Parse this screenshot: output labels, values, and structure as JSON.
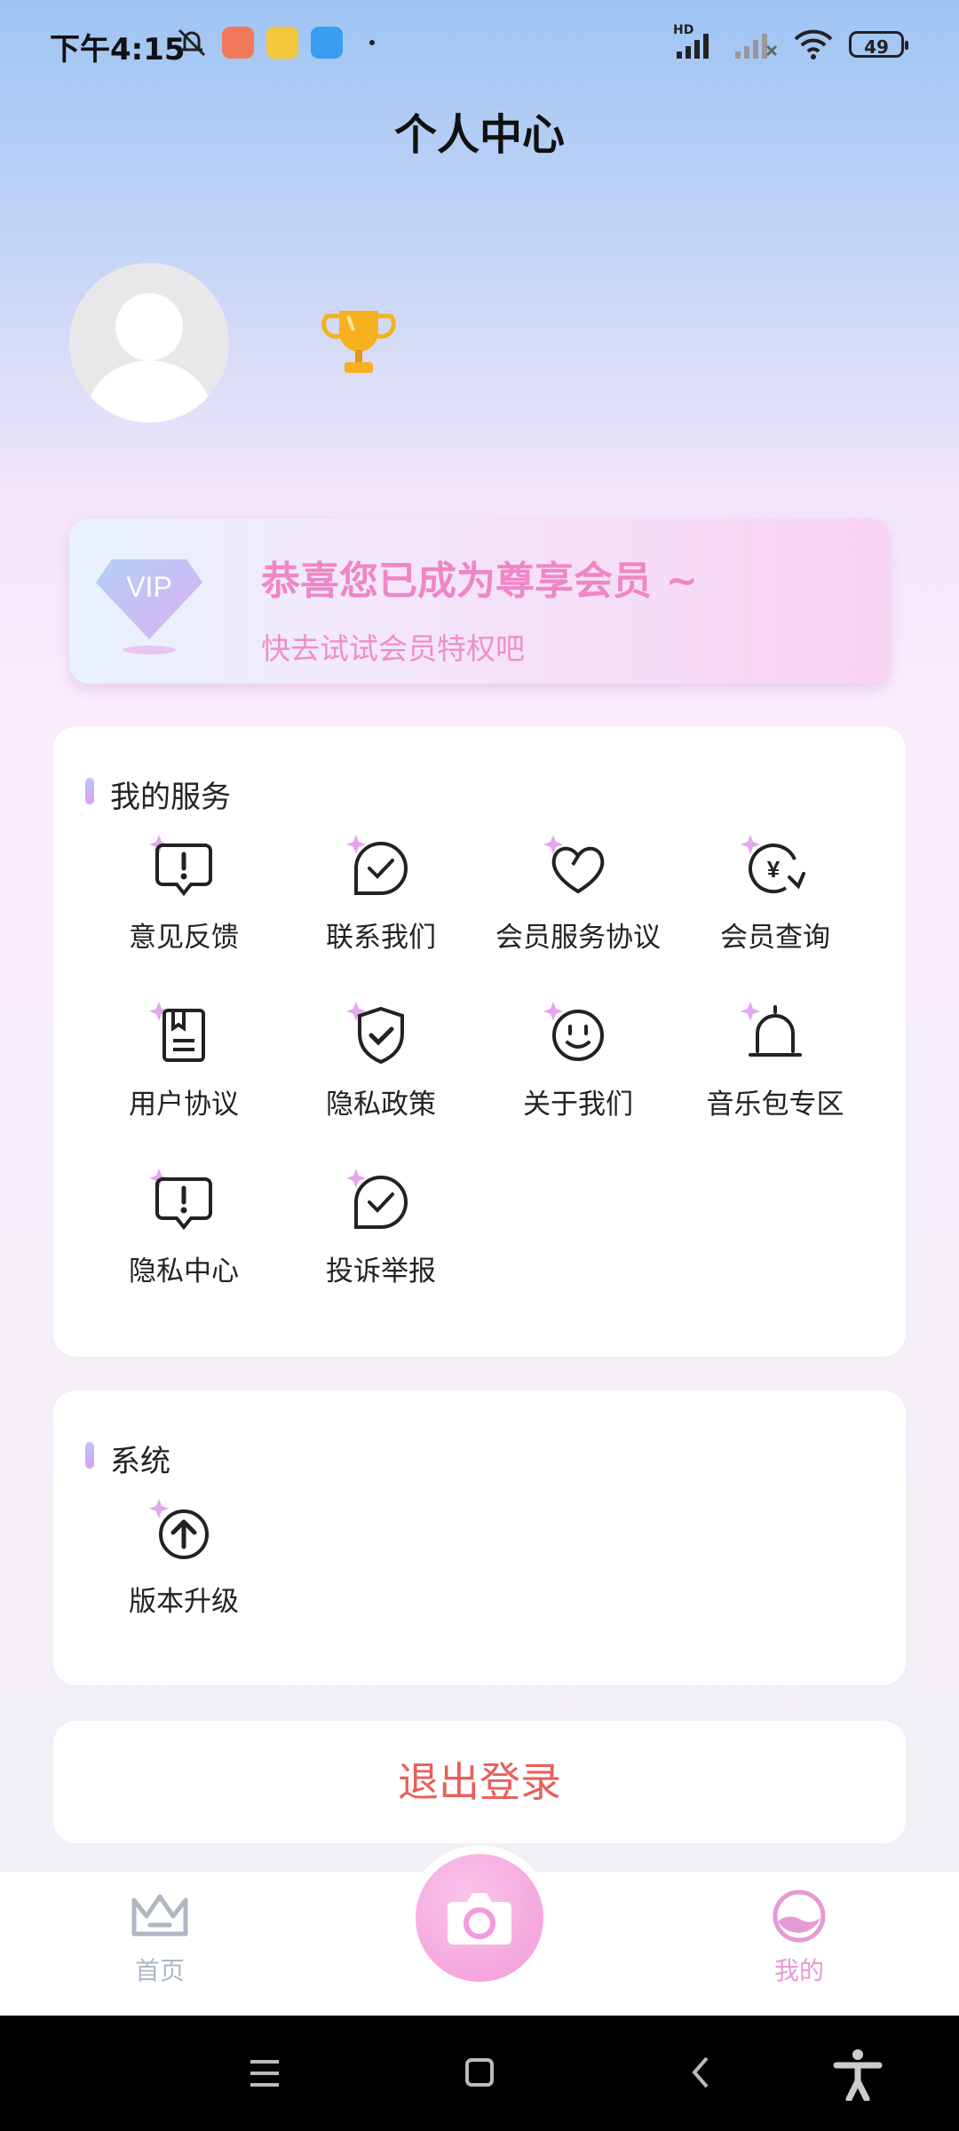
{
  "status_bar": {
    "time": "下午4:15",
    "battery": "49",
    "network_label": "HD"
  },
  "header": {
    "title": "个人中心"
  },
  "vip_card": {
    "badge": "VIP",
    "headline": "恭喜您已成为尊享会员 ~",
    "subline": "快去试试会员特权吧"
  },
  "services": {
    "title": "我的服务",
    "items": [
      {
        "label": "意见反馈",
        "icon": "feedback-icon"
      },
      {
        "label": "联系我们",
        "icon": "chat-check-icon"
      },
      {
        "label": "会员服务协议",
        "icon": "heart-icon"
      },
      {
        "label": "会员查询",
        "icon": "yen-refresh-icon"
      },
      {
        "label": "用户协议",
        "icon": "document-icon"
      },
      {
        "label": "隐私政策",
        "icon": "shield-check-icon"
      },
      {
        "label": "关于我们",
        "icon": "smile-icon"
      },
      {
        "label": "音乐包专区",
        "icon": "bell-icon"
      },
      {
        "label": "隐私中心",
        "icon": "feedback-icon"
      },
      {
        "label": "投诉举报",
        "icon": "chat-check-icon"
      }
    ]
  },
  "system": {
    "title": "系统",
    "items": [
      {
        "label": "版本升级",
        "icon": "upload-arrow-icon"
      }
    ]
  },
  "logout": {
    "label": "退出登录"
  },
  "tabbar": {
    "home": "首页",
    "mine": "我的"
  },
  "colors": {
    "accent_pink": "#ef86c6",
    "logout_red": "#e8605c",
    "tab_active": "#e69ad6",
    "tab_inactive": "#aeb7c4"
  }
}
